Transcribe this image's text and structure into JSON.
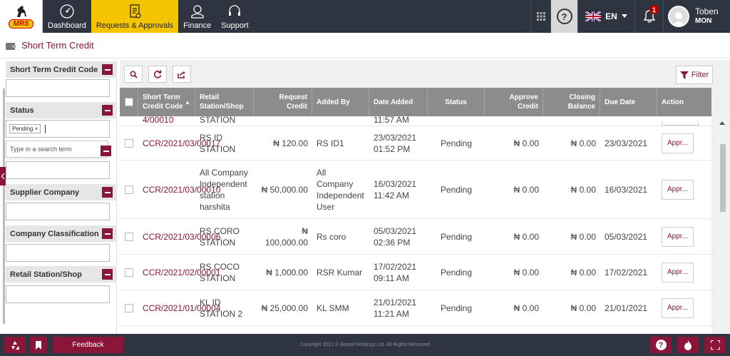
{
  "brand": {
    "logo_text": "MRS"
  },
  "nav": {
    "items": [
      {
        "label": "Dashboard",
        "icon": "dashboard-icon",
        "active": false
      },
      {
        "label": "Requests & Approvals",
        "icon": "document-icon",
        "active": true
      },
      {
        "label": "Finance",
        "icon": "finance-icon",
        "active": false
      },
      {
        "label": "Support",
        "icon": "headset-icon",
        "active": false
      }
    ],
    "help": "?",
    "language": "EN",
    "notifications": "1",
    "user": {
      "name": "Toben",
      "sub": "MON"
    }
  },
  "page": {
    "title": "Short Term Credit"
  },
  "filters": {
    "short_term_credit_code": "Short Term Credit Code",
    "status": "Status",
    "status_chip": "Pending",
    "chip_remove": "×",
    "dropdown_hint": "Type in a search term",
    "supplier_company": "Supplier Company",
    "company_classification": "Company Classification",
    "retail_station": "Retail Station/Shop"
  },
  "toolbar": {
    "filter_label": "Filter"
  },
  "table": {
    "headers": {
      "code": "Short Term Credit Code",
      "station": "Retail Station/Shop",
      "request_credit": "Request Credit",
      "added_by": "Added By",
      "date_added": "Date Added",
      "status": "Status",
      "approve_credit": "Approve Credit",
      "closing_balance": "Closing Balance",
      "due_date": "Due Date",
      "action": "Action"
    },
    "partial_row": {
      "code": "4/00010",
      "station": "STATION",
      "date": "11:57 AM"
    },
    "rows": [
      {
        "code": "CCR/2021/03/00017",
        "station": "RS ID STATION",
        "request": "₦ 120.00",
        "added_by": "RS ID1",
        "date": "23/03/2021",
        "time": "01:52 PM",
        "status": "Pending",
        "approve": "₦ 0.00",
        "closing": "₦ 0.00",
        "due": "23/03/2021",
        "action": "Appr..."
      },
      {
        "code": "CCR/2021/03/00010",
        "station": "All Company Independent station harshita",
        "request": "₦ 50,000.00",
        "added_by": "All Company Independent User",
        "date": "16/03/2021",
        "time": "11:42 AM",
        "status": "Pending",
        "approve": "₦ 0.00",
        "closing": "₦ 0.00",
        "due": "16/03/2021",
        "action": "Appr..."
      },
      {
        "code": "CCR/2021/03/00006",
        "station": "RS CORO STATION",
        "request": "₦ 100,000.00",
        "added_by": "Rs coro",
        "date": "05/03/2021",
        "time": "02:36 PM",
        "status": "Pending",
        "approve": "₦ 0.00",
        "closing": "₦ 0.00",
        "due": "05/03/2021",
        "action": "Appr..."
      },
      {
        "code": "CCR/2021/02/00001",
        "station": "RS COCO STATION",
        "request": "₦ 1,000.00",
        "added_by": "RSR Kumar",
        "date": "17/02/2021",
        "time": "09:11 AM",
        "status": "Pending",
        "approve": "₦ 0.00",
        "closing": "₦ 0.00",
        "due": "17/02/2021",
        "action": "Appr..."
      },
      {
        "code": "CCR/2021/01/00004",
        "station": "KL ID STATION 2",
        "request": "₦ 25,000.00",
        "added_by": "KL SMM",
        "date": "21/01/2021",
        "time": "11:21 AM",
        "status": "Pending",
        "approve": "₦ 0.00",
        "closing": "₦ 0.00",
        "due": "21/01/2021",
        "action": "Appr..."
      }
    ]
  },
  "footer": {
    "feedback": "Feedback",
    "copyright": "Copyright 2021 © Bestaf Holdings Ltd. All Rights Reserved",
    "help": "?"
  },
  "colors": {
    "accent": "#8b1538",
    "nav_bg": "#2e3440",
    "active_tab": "#f5c400",
    "header_bg": "#8c8c8c"
  }
}
